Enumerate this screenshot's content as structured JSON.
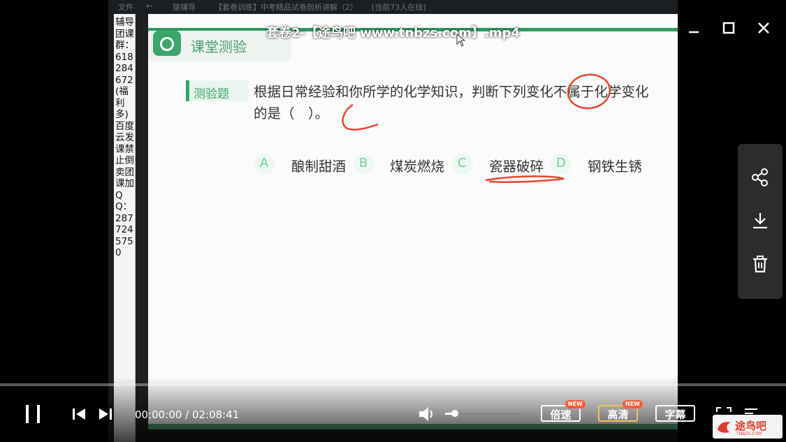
{
  "video": {
    "title": "套卷2-【途鸟吧 www.tnbzs.com】.mp4",
    "current_time": "00:00:00 / 02:08:41",
    "progress": 0,
    "volume": 0.12
  },
  "recorded_app": {
    "file_menu": "文件",
    "app_name": "猿辅导",
    "course_title": "【套卷训练】中考精品试卷剖析讲解（2）",
    "online_count": "[当前73人在线]",
    "side_notice": "辅导团课群：618284672(福利多)百度云发课禁止倒卖团课加QQ：2877245750"
  },
  "slide": {
    "section_title": "课堂测验",
    "tag_label": "测验题",
    "question": "根据日常经验和你所学的化学知识，判断下列变化不属于化学变化的是（　）。",
    "options": [
      {
        "letter": "A",
        "text": "酿制甜酒"
      },
      {
        "letter": "B",
        "text": "煤炭燃烧"
      },
      {
        "letter": "C",
        "text": "瓷器破碎"
      },
      {
        "letter": "D",
        "text": "钢铁生锈"
      }
    ],
    "annotation_color": "#e8452f"
  },
  "controls": {
    "speed_label": "倍速",
    "quality_label": "高清",
    "subtitle_label": "字幕",
    "new_badge": "NEW"
  },
  "watermark": {
    "text": "途鸟吧",
    "sub": "TNBZS.COM"
  },
  "colors": {
    "brand_green": "#2e9a5e",
    "option_letter": "#6ecf9a"
  }
}
